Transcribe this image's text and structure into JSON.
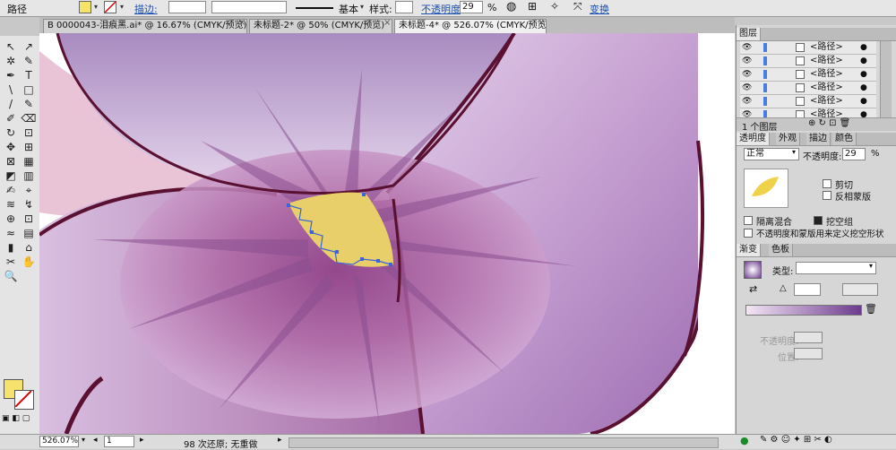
{
  "control_bar": {
    "object_type": "路径",
    "fill_color": "#f6e36b",
    "stroke_label": "描边:",
    "stroke_style_label": "基本",
    "style_label": "样式:",
    "opacity_label": "不透明度",
    "opacity_value": "29",
    "opacity_unit": "%",
    "transform_label": "变换"
  },
  "tabs": [
    {
      "label": "B 0000043-泪痕黑.ai* @ 16.67% (CMYK/预览)",
      "close": "×"
    },
    {
      "label": "未标题-2* @ 50% (CMYK/预览)",
      "close": "×"
    },
    {
      "label": "未标题-4* @ 526.07% (CMYK/预览)",
      "close": "×"
    }
  ],
  "tools": [
    "↖",
    "↗",
    "✲",
    "✎",
    "✒",
    "T",
    "\\",
    "□",
    "/",
    "✎",
    "✐",
    "⌫",
    "↻",
    "⊡",
    "✥",
    "⊞",
    "⊠",
    "▦",
    "◩",
    "▥",
    "✍",
    "⌖",
    "≋",
    "↯",
    "⊕",
    "⊡",
    "≈",
    "▤",
    "▮",
    "⌂",
    "✂",
    "✋",
    "🔍"
  ],
  "toolbox_colors": {
    "fill": "#f6e36b",
    "stroke": "#ffffff"
  },
  "layers_panel": {
    "title": "图层",
    "items": [
      "<路径>",
      "<路径>",
      "<路径>",
      "<路径>",
      "<路径>",
      "<路径>"
    ],
    "footer": "1 个图层"
  },
  "transparency_panel": {
    "tabs": [
      "透明度",
      "外观",
      "描边",
      "颜色"
    ],
    "blend_mode": "正常",
    "opacity_label": "不透明度:",
    "opacity_value": "29",
    "opacity_unit": "%",
    "clip_label": "剪切",
    "invert_mask_label": "反相蒙版",
    "isolate_blend_label": "隔离混合",
    "knockout_group_label": "挖空组",
    "opacity_mask_label": "不透明度和蒙版用来定义挖空形状"
  },
  "gradient_panel": {
    "tabs": [
      "渐变",
      "色板"
    ],
    "type_label": "类型:",
    "opacity_label": "不透明度:",
    "position_label": "位置:",
    "gradient_start": "#f3e6f4",
    "gradient_end": "#6d3b8e"
  },
  "status_bar": {
    "zoom": "526.07%",
    "page": "1",
    "message": "98 次还原; 无重做"
  }
}
